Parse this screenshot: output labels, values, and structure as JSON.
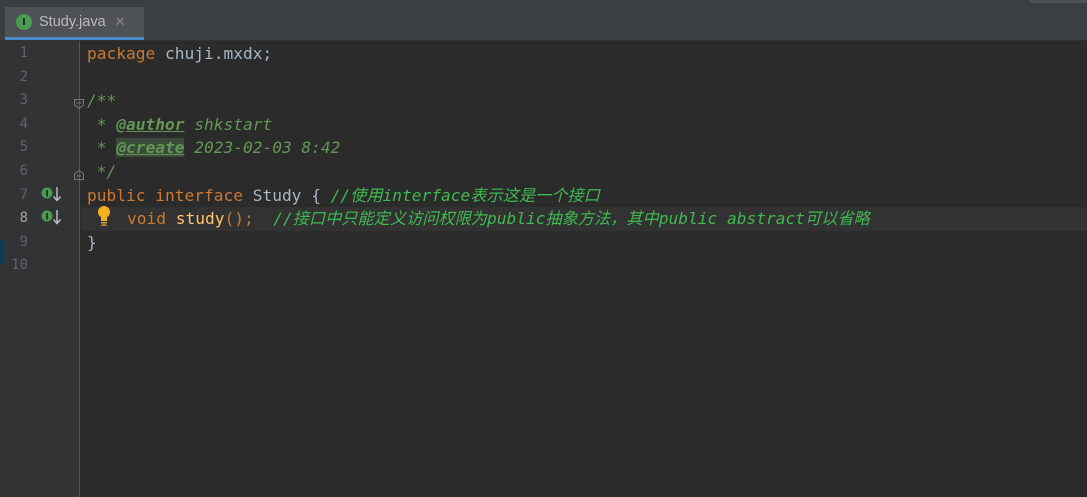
{
  "tab": {
    "label": "Study.java",
    "icon": "interface-icon",
    "icon_letter": "I",
    "close": "✕"
  },
  "gutter": {
    "line_numbers": [
      "1",
      "2",
      "3",
      "4",
      "5",
      "6",
      "7",
      "8",
      "9",
      "10"
    ],
    "current_line": "8"
  },
  "code": {
    "l1_kw": "package",
    "l1_rest": " chuji.mxdx;",
    "l3": "/**",
    "l4_prefix": " * ",
    "l4_tag": "@author",
    "l4_rest": " shkstart",
    "l5_prefix": " * ",
    "l5_tag": "@create",
    "l5_rest": " 2023-02-03 8:42",
    "l6": " */",
    "l7_kw1": "public",
    "l7_kw2": "interface",
    "l7_name": "Study",
    "l7_brace": "{",
    "l7_comment": "//使用interface表示这是一个接口",
    "l8_kw": "void",
    "l8_fn": "study",
    "l8_rest": "();",
    "l8_comment": "//接口中只能定义访问权限为public抽象方法，其中public abstract可以省略",
    "l9": "}"
  },
  "colors": {
    "background": "#2b2b2b",
    "keyword": "#cc7832",
    "comment": "#3fb950",
    "doc": "#629755",
    "method": "#ffc66d",
    "tab_underline": "#4a88c7"
  }
}
